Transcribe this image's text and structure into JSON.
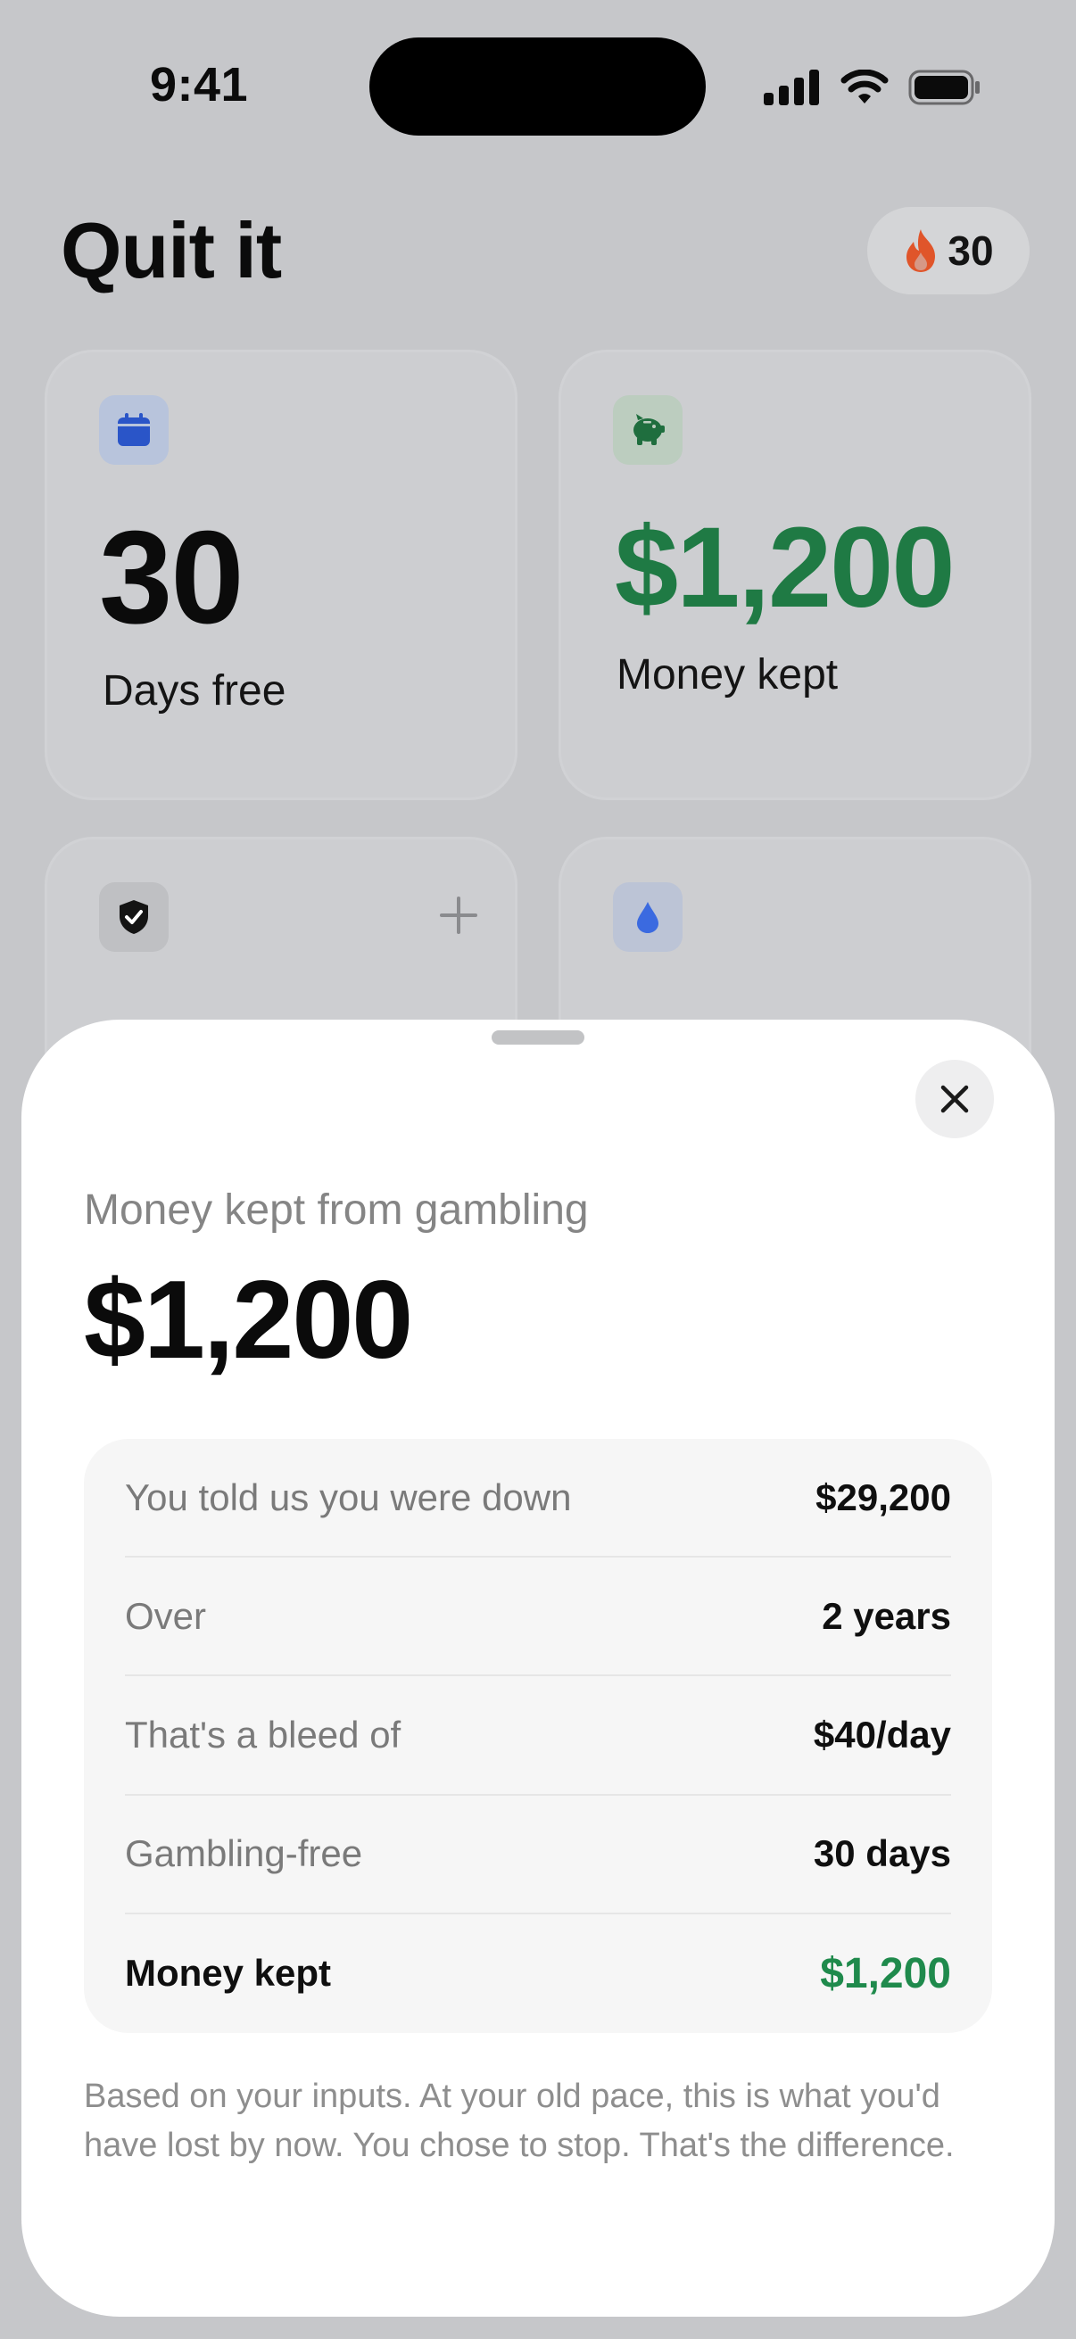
{
  "status_bar": {
    "time": "9:41",
    "icons": [
      "signal-icon",
      "wifi-icon",
      "battery-icon"
    ]
  },
  "header": {
    "title": "Quit it",
    "streak": {
      "icon": "flame-icon",
      "count": "30"
    }
  },
  "cards": [
    {
      "icon": "calendar-icon",
      "value": "30",
      "label": "Days free"
    },
    {
      "icon": "piggy-bank-icon",
      "value": "$1,200",
      "label": "Money kept"
    },
    {
      "icon": "shield-check-icon",
      "action_icon": "plus-icon"
    },
    {
      "icon": "water-drop-icon"
    }
  ],
  "sheet": {
    "close_icon": "close-icon",
    "subtitle": "Money kept from gambling",
    "amount": "$1,200",
    "rows": [
      {
        "label": "You told us you were down",
        "value": "$29,200"
      },
      {
        "label": "Over",
        "value": "2 years"
      },
      {
        "label": "That's a bleed of",
        "value": "$40/day"
      },
      {
        "label": "Gambling-free",
        "value": "30 days"
      },
      {
        "label": "Money kept",
        "value": "$1,200"
      }
    ],
    "footnote": "Based on your inputs. At your old pace, this is what you'd have lost by now. You chose to stop. That's the difference."
  },
  "colors": {
    "accent_green": "#1f8a4c",
    "calendar_blue": "#2a55c8",
    "drop_blue": "#3b6ae0",
    "flame_orange": "#e0552a"
  }
}
